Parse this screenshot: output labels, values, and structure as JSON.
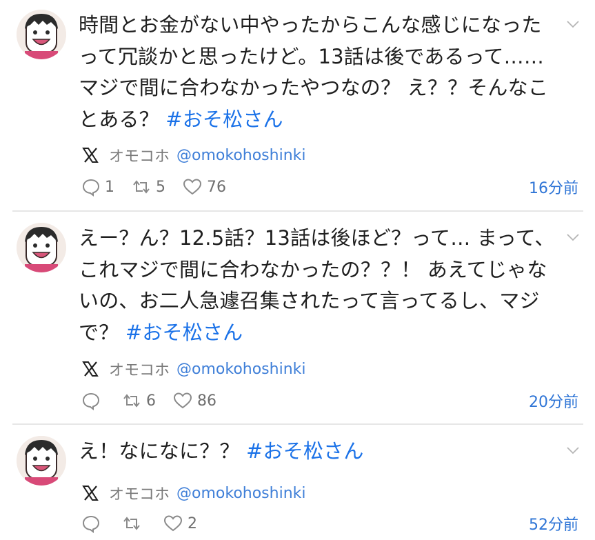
{
  "tweets": [
    {
      "text": "時間とお金がない中やったからこんな感じになったって冗談かと思ったけど。13話は後であるって……マジで間に合わなかったやつなの？ え？？そんなことある？ ",
      "hashtag": "#おそ松さん",
      "source_name": "オモコホ",
      "handle": "@omokohoshinki",
      "replies": "1",
      "retweets": "5",
      "likes": "76",
      "time": "16分前"
    },
    {
      "text": "えー？ん？12.5話？13話は後ほど？って… まって、これマジで間に合わなかったの？？！ あえてじゃないの、お二人急遽召集されたって言ってるし、マジで？ ",
      "hashtag": "#おそ松さん",
      "source_name": "オモコホ",
      "handle": "@omokohoshinki",
      "replies": "",
      "retweets": "6",
      "likes": "86",
      "time": "20分前"
    },
    {
      "text": "え！なになに？？ ",
      "hashtag": "#おそ松さん",
      "source_name": "オモコホ",
      "handle": "@omokohoshinki",
      "replies": "",
      "retweets": "",
      "likes": "2",
      "time": "52分前"
    }
  ],
  "colors": {
    "hashtag": "#1b72e8",
    "handle": "#3f7fd8",
    "time": "#2f75d6",
    "meta": "#7a7a7a"
  },
  "icons": {
    "source": "x-logo-icon",
    "reply": "speech-bubble-icon",
    "retweet": "retweet-icon",
    "like": "heart-icon",
    "menu": "chevron-down-icon"
  }
}
